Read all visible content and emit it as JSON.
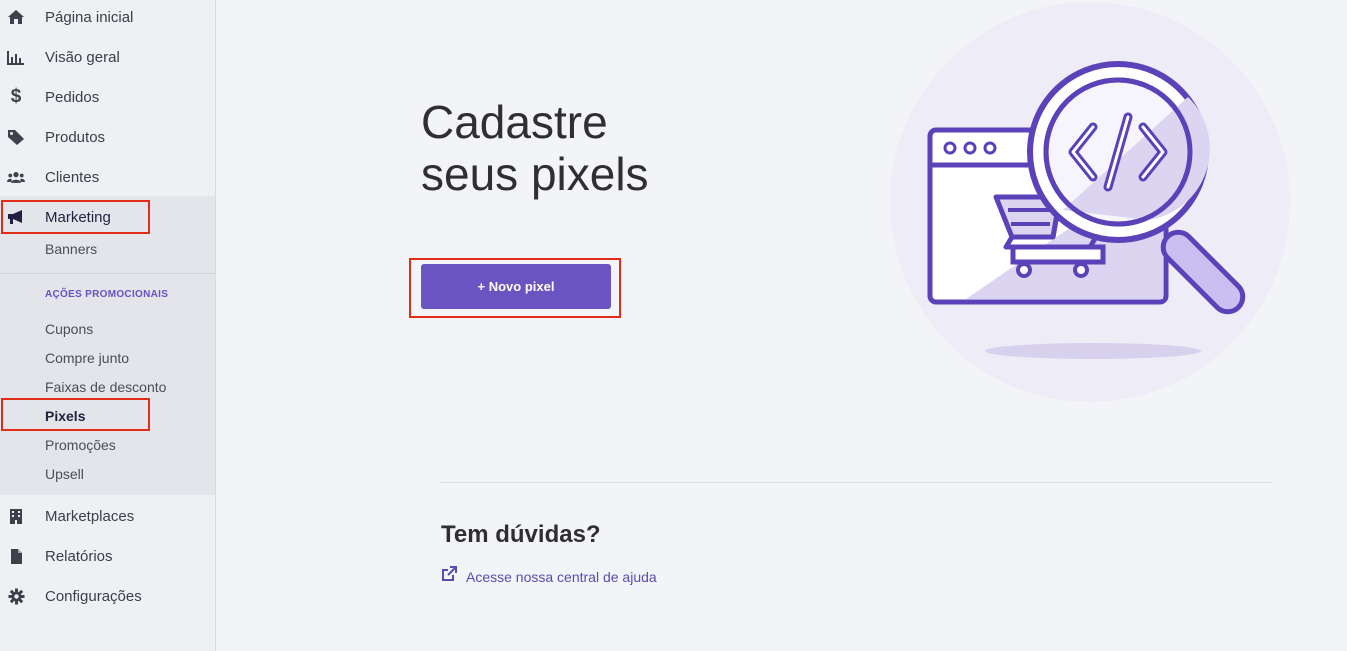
{
  "sidebar": {
    "items_top": [
      {
        "label": "Página inicial",
        "icon": "home-icon"
      },
      {
        "label": "Visão geral",
        "icon": "bar-chart-icon"
      },
      {
        "label": "Pedidos",
        "icon": "dollar-icon"
      },
      {
        "label": "Produtos",
        "icon": "tag-icon"
      },
      {
        "label": "Clientes",
        "icon": "users-icon"
      },
      {
        "label": "Marketing",
        "icon": "megaphone-icon"
      }
    ],
    "marketing_sub": {
      "banners": "Banners",
      "section_heading": "AÇÕES PROMOCIONAIS",
      "items": [
        "Cupons",
        "Compre junto",
        "Faixas de desconto",
        "Pixels",
        "Promoções",
        "Upsell"
      ],
      "active": "Pixels"
    },
    "items_bottom": [
      {
        "label": "Marketplaces",
        "icon": "building-icon"
      },
      {
        "label": "Relatórios",
        "icon": "file-icon"
      },
      {
        "label": "Configurações",
        "icon": "gear-icon"
      }
    ]
  },
  "main": {
    "title_line1": "Cadastre",
    "title_line2": "seus pixels",
    "cta_label": "+ Novo pixel",
    "help_title": "Tem dúvidas?",
    "help_link": "Acesse nossa central de ajuda",
    "help_link_icon": "external-link-icon",
    "illustration": "magnifier-code-cart-illustration"
  },
  "colors": {
    "accent": "#6a54c1",
    "highlight": "#e32c18",
    "sidebar_bg": "#eef0f3",
    "page_bg": "#f3f4f8"
  }
}
